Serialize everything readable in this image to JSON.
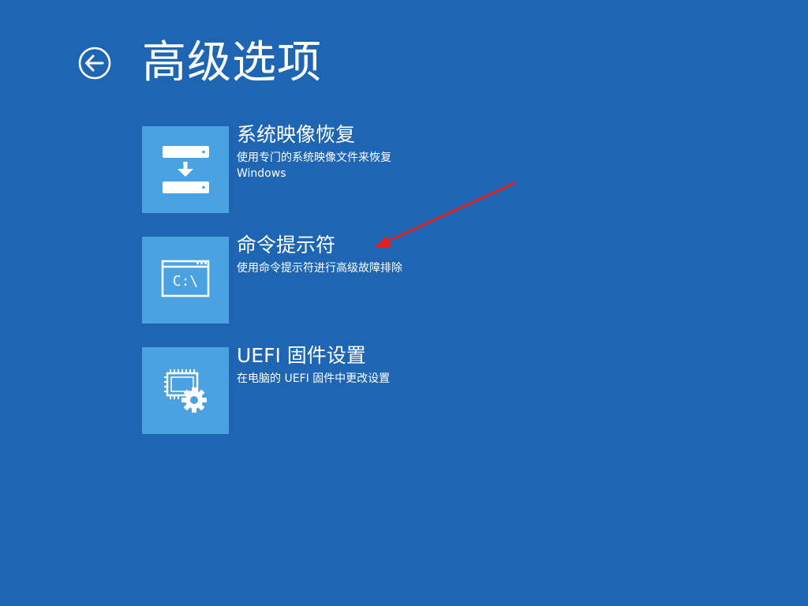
{
  "screen": {
    "title": "高级选项",
    "background_color": "#1e66b4",
    "tile_color": "#4aa2e0"
  },
  "back": {
    "icon": "back-arrow-circle-icon"
  },
  "options": [
    {
      "title": "系统映像恢复",
      "description": "使用专门的系统映像文件来恢复 Windows",
      "icon": "system-image-recovery-icon"
    },
    {
      "title": "命令提示符",
      "description": "使用命令提示符进行高级故障排除",
      "icon": "command-prompt-icon",
      "icon_text": "C:\\"
    },
    {
      "title": "UEFI 固件设置",
      "description": "在电脑的 UEFI 固件中更改设置",
      "icon": "uefi-firmware-settings-icon"
    }
  ],
  "annotation": {
    "arrow_color": "#e02020",
    "points_to": "命令提示符"
  }
}
